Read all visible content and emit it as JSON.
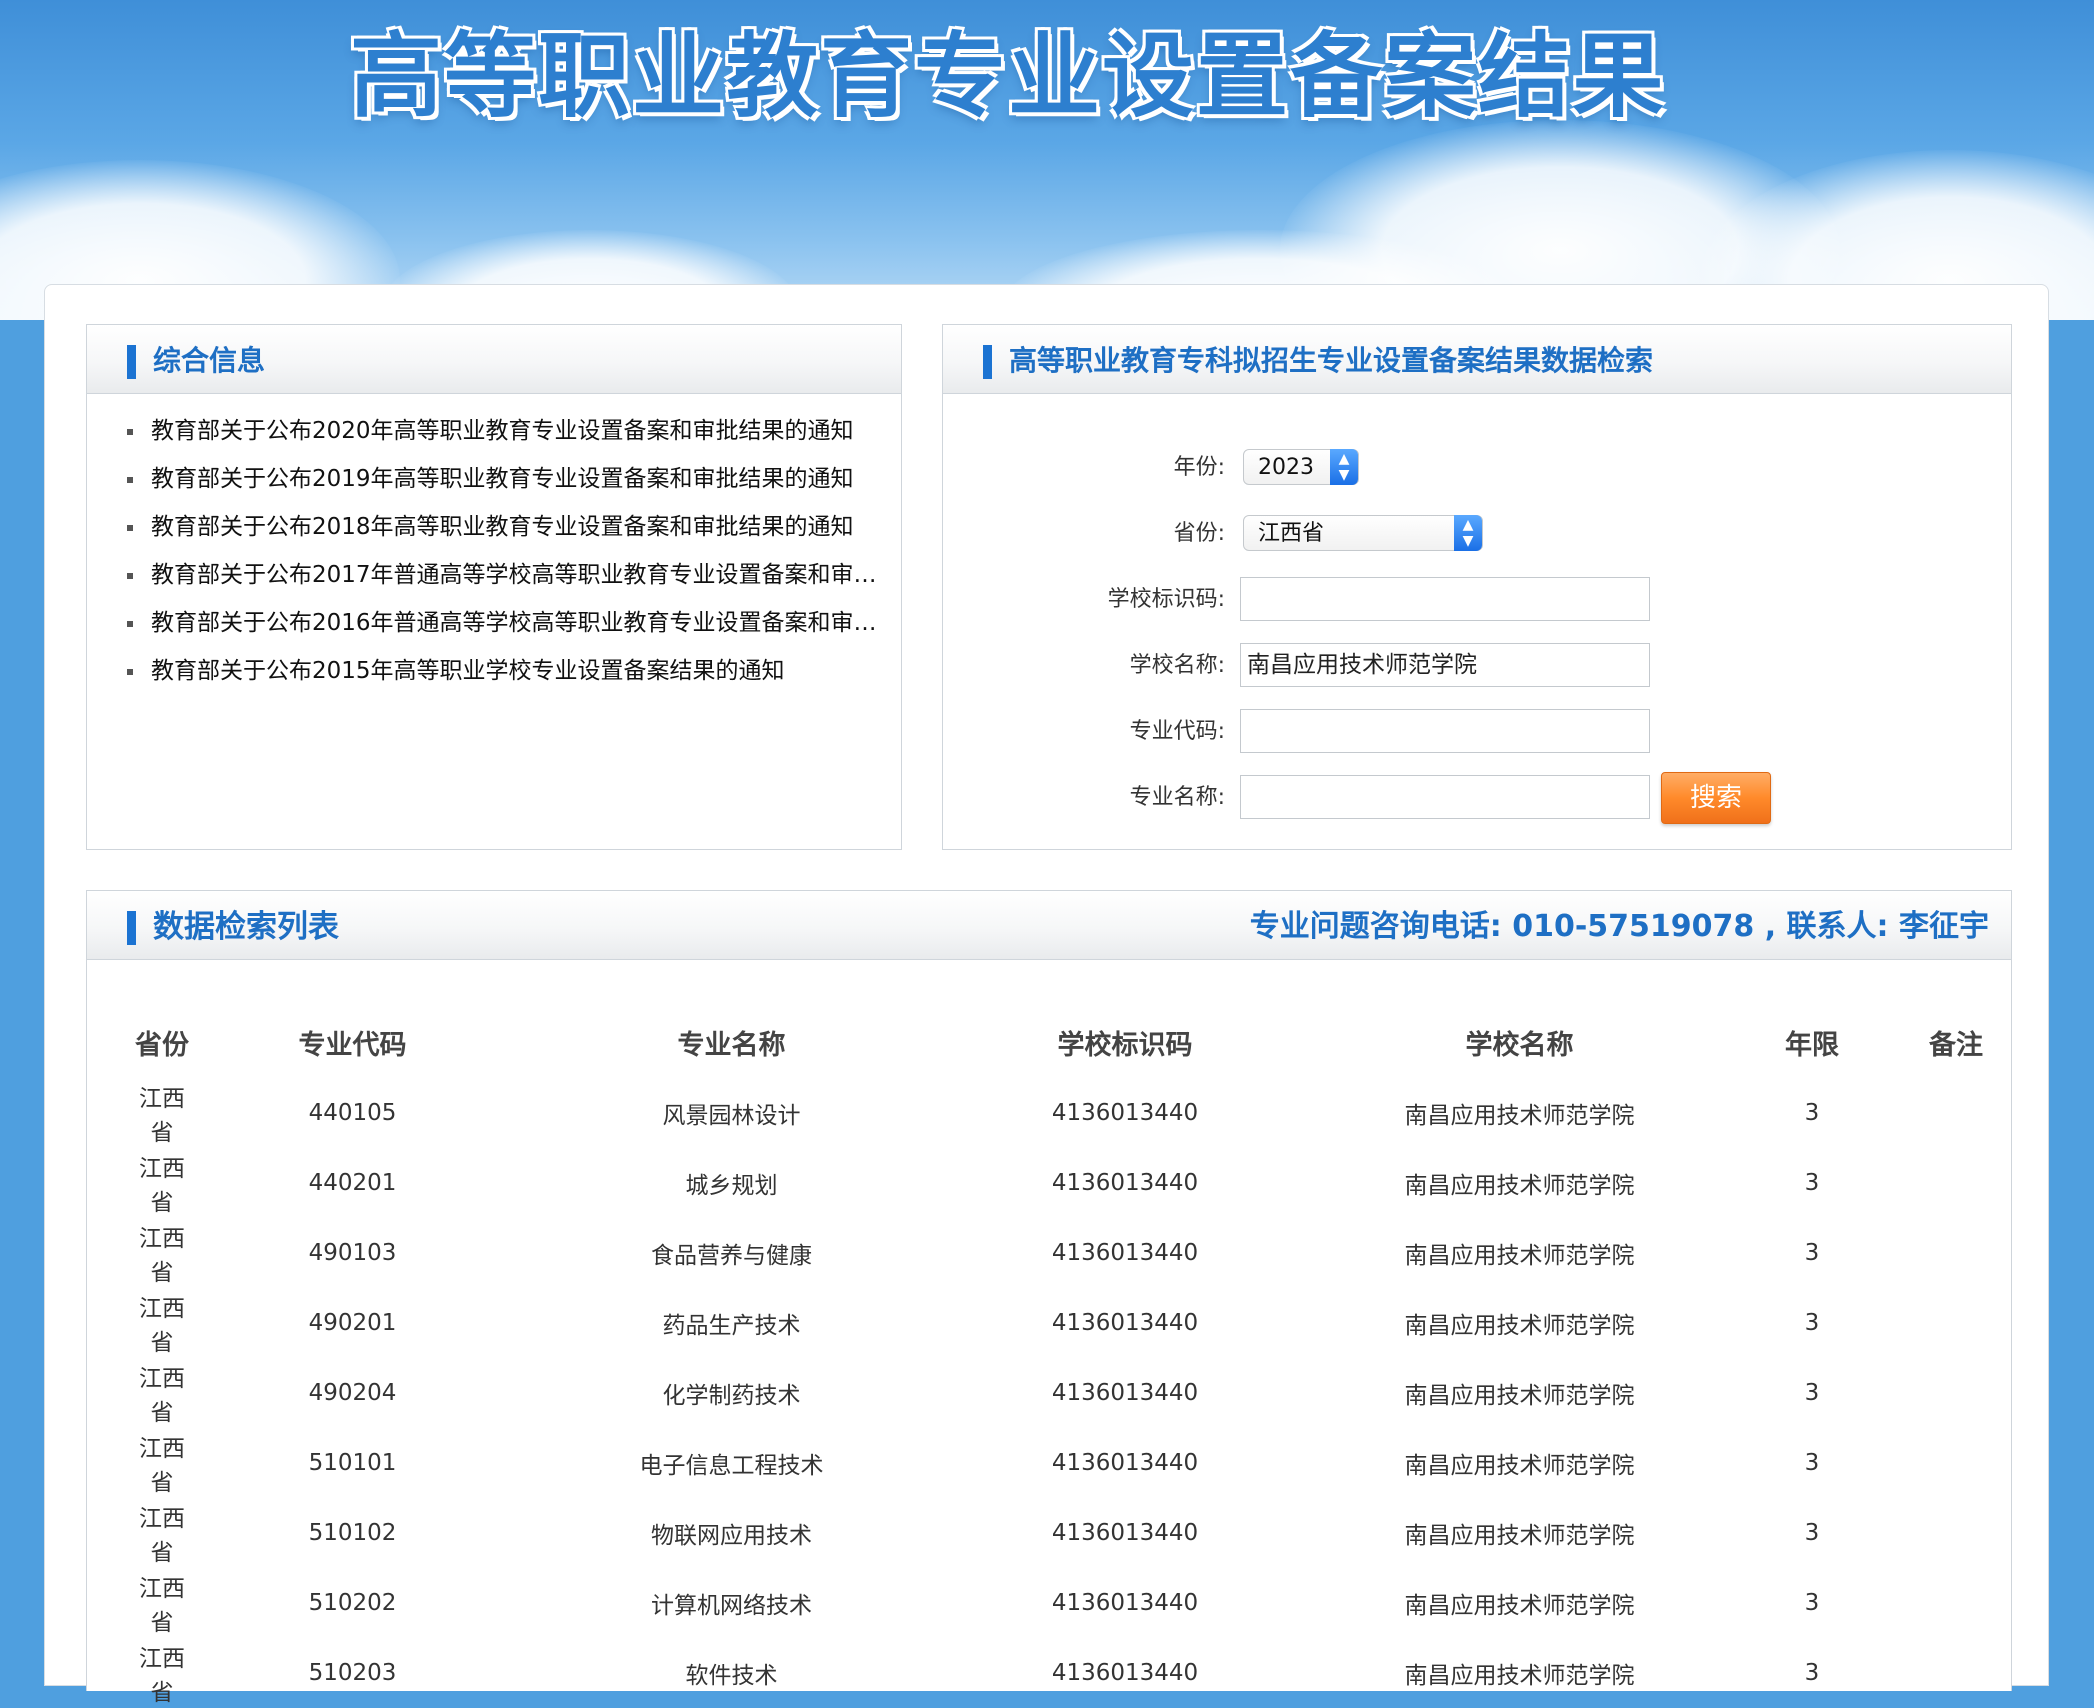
{
  "banner": {
    "title": "高等职业教育专业设置备案结果"
  },
  "info_panel": {
    "title": "综合信息",
    "items": [
      "教育部关于公布2020年高等职业教育专业设置备案和审批结果的通知",
      "教育部关于公布2019年高等职业教育专业设置备案和审批结果的通知",
      "教育部关于公布2018年高等职业教育专业设置备案和审批结果的通知",
      "教育部关于公布2017年普通高等学校高等职业教育专业设置备案和审…",
      "教育部关于公布2016年普通高等学校高等职业教育专业设置备案和审…",
      "教育部关于公布2015年高等职业学校专业设置备案结果的通知"
    ]
  },
  "search_panel": {
    "title": "高等职业教育专科拟招生专业设置备案结果数据检索",
    "year_label": "年份:",
    "year_value": "2023",
    "province_label": "省份:",
    "province_value": "江西省",
    "school_code_label": "学校标识码:",
    "school_code_value": "",
    "school_name_label": "学校名称:",
    "school_name_value": "南昌应用技术师范学院",
    "major_code_label": "专业代码:",
    "major_code_value": "",
    "major_name_label": "专业名称:",
    "major_name_value": "",
    "search_button": "搜索"
  },
  "results": {
    "title": "数据检索列表",
    "contact": "专业问题咨询电话: 010-57519078 , 联系人: 李征宇",
    "columns": [
      "省份",
      "专业代码",
      "专业名称",
      "学校标识码",
      "学校名称",
      "年限",
      "备注"
    ],
    "rows": [
      [
        "江西省",
        "440105",
        "风景园林设计",
        "4136013440",
        "南昌应用技术师范学院",
        "3",
        ""
      ],
      [
        "江西省",
        "440201",
        "城乡规划",
        "4136013440",
        "南昌应用技术师范学院",
        "3",
        ""
      ],
      [
        "江西省",
        "490103",
        "食品营养与健康",
        "4136013440",
        "南昌应用技术师范学院",
        "3",
        ""
      ],
      [
        "江西省",
        "490201",
        "药品生产技术",
        "4136013440",
        "南昌应用技术师范学院",
        "3",
        ""
      ],
      [
        "江西省",
        "490204",
        "化学制药技术",
        "4136013440",
        "南昌应用技术师范学院",
        "3",
        ""
      ],
      [
        "江西省",
        "510101",
        "电子信息工程技术",
        "4136013440",
        "南昌应用技术师范学院",
        "3",
        ""
      ],
      [
        "江西省",
        "510102",
        "物联网应用技术",
        "4136013440",
        "南昌应用技术师范学院",
        "3",
        ""
      ],
      [
        "江西省",
        "510202",
        "计算机网络技术",
        "4136013440",
        "南昌应用技术师范学院",
        "3",
        ""
      ],
      [
        "江西省",
        "510203",
        "软件技术",
        "4136013440",
        "南昌应用技术师范学院",
        "3",
        ""
      ]
    ]
  }
}
